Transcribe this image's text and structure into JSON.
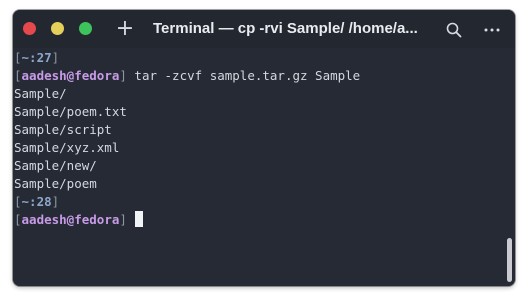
{
  "window": {
    "title": "Terminal — cp -rvi Sample/ /home/a...",
    "newtab_glyph": "+",
    "colors": {
      "background": "#252a35",
      "close": "#e5484d",
      "minimize": "#e3cf5a",
      "maximize": "#3ec35c",
      "username": "#c79be6",
      "path": "#8fa6c9"
    }
  },
  "icons": {
    "search": "search-icon",
    "menu": "more-horizontal-icon",
    "close": "close-icon",
    "minimize": "minimize-icon",
    "maximize": "maximize-icon",
    "newtab": "plus-icon"
  },
  "terminal": {
    "prompt1": {
      "open": "[",
      "path": "~:27",
      "close": "]"
    },
    "prompt2": {
      "open": "[",
      "user": "aadesh@fedora",
      "close": "]",
      "command": " tar -zcvf sample.tar.gz Sample"
    },
    "output": [
      "Sample/",
      "Sample/poem.txt",
      "Sample/script",
      "Sample/xyz.xml",
      "Sample/new/",
      "Sample/poem"
    ],
    "prompt3": {
      "open": "[",
      "path": "~:28",
      "close": "]"
    },
    "prompt4": {
      "open": "[",
      "user": "aadesh@fedora",
      "close": "]"
    }
  }
}
